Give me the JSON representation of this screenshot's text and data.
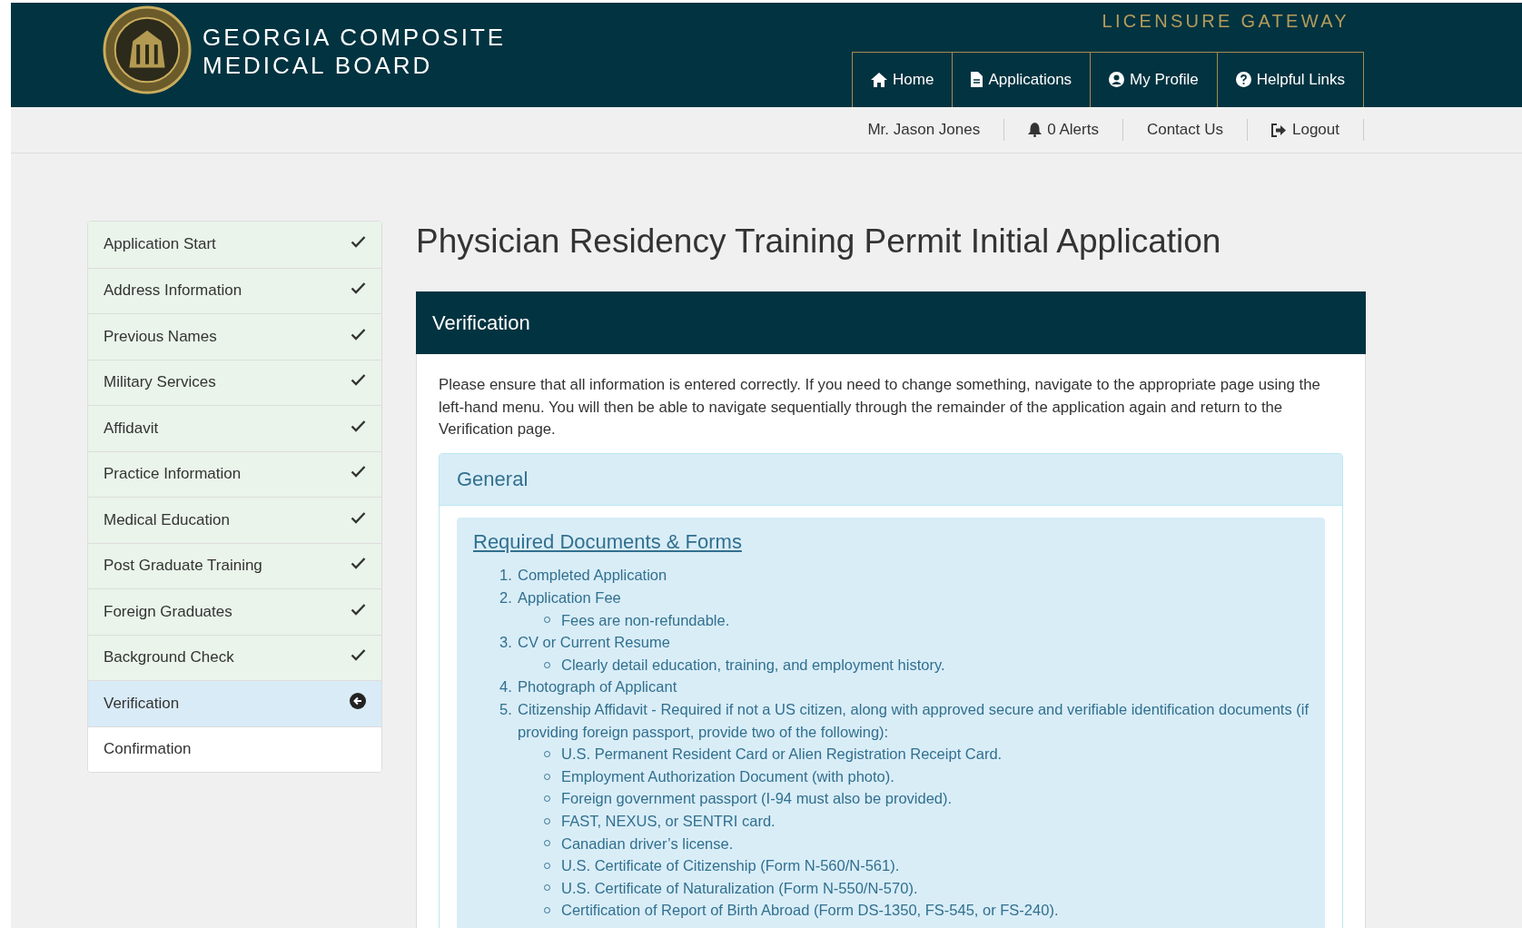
{
  "header": {
    "org_name_lines": [
      "GEORGIA COMPOSITE",
      "MEDICAL BOARD"
    ],
    "portal_name": "LICENSURE GATEWAY",
    "nav": [
      {
        "label": "Home",
        "kind": "home"
      },
      {
        "label": "Applications",
        "kind": "document"
      },
      {
        "label": "My Profile",
        "kind": "profile"
      },
      {
        "label": "Helpful Links",
        "kind": "help"
      }
    ]
  },
  "user_bar": [
    {
      "label": "Mr. Jason Jones",
      "kind": "user"
    },
    {
      "label": "0 Alerts",
      "kind": "alerts"
    },
    {
      "label": "Contact Us",
      "kind": "contact"
    },
    {
      "label": "Logout",
      "kind": "logout"
    }
  ],
  "sidebar": {
    "items": [
      {
        "label": "Application Start",
        "completed": true,
        "selected": false
      },
      {
        "label": "Address Information",
        "completed": true,
        "selected": false
      },
      {
        "label": "Previous Names",
        "completed": true,
        "selected": false
      },
      {
        "label": "Military Services",
        "completed": true,
        "selected": false
      },
      {
        "label": "Affidavit",
        "completed": true,
        "selected": false
      },
      {
        "label": "Practice Information",
        "completed": true,
        "selected": false
      },
      {
        "label": "Medical Education",
        "completed": true,
        "selected": false
      },
      {
        "label": "Post Graduate Training",
        "completed": true,
        "selected": false
      },
      {
        "label": "Foreign Graduates",
        "completed": true,
        "selected": false
      },
      {
        "label": "Background Check",
        "completed": true,
        "selected": false
      },
      {
        "label": "Verification",
        "completed": false,
        "selected": true
      },
      {
        "label": "Confirmation",
        "completed": false,
        "selected": false
      }
    ]
  },
  "page_title": "Physician Residency Training Permit Initial Application",
  "section": {
    "title": "Verification",
    "intro": "Please ensure that all information is entered correctly. If you need to change something, navigate to the appropriate page using the left-hand menu. You will then be able to navigate sequentially through the remainder of the application again and return to the Verification page.",
    "panel": {
      "title": "General",
      "link": "Required Documents & Forms",
      "items": [
        {
          "number": "1.",
          "text": "Completed Application"
        },
        {
          "number": "2.",
          "text": "Application Fee",
          "children": [
            "Fees are non-refundable."
          ]
        },
        {
          "number": "3.",
          "text": "CV or Current Resume",
          "children": [
            "Clearly detail education, training, and employment history."
          ]
        },
        {
          "number": "4.",
          "text": "Photograph of Applicant"
        },
        {
          "number": "5.",
          "text": "Citizenship Affidavit - Required if not a US citizen, along with approved secure and verifiable identification documents (if providing foreign passport, provide two of the following):",
          "children": [
            "U.S. Permanent Resident Card or Alien Registration Receipt Card.",
            "Employment Authorization Document (with photo).",
            "Foreign government passport (I-94 must also be provided).",
            "FAST, NEXUS, or SENTRI card.",
            "Canadian driver’s license.",
            "U.S. Certificate of Citizenship (Form N-560/N-561).",
            "U.S. Certificate of Naturalization (Form N-550/N-570).",
            "Certification of Report of Birth Abroad (Form DS-1350, FS-545, or FS-240)."
          ]
        }
      ]
    }
  }
}
